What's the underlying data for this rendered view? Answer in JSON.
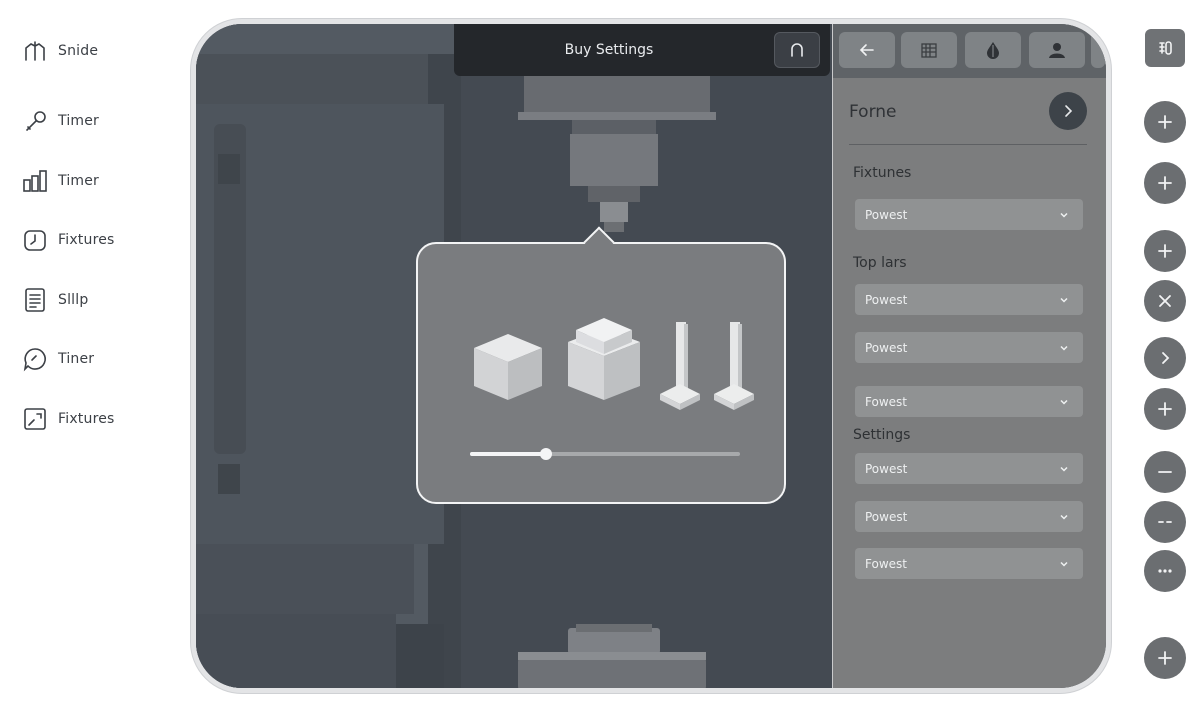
{
  "left_menu": [
    {
      "label": "Snide",
      "icon": "tuning-fork-icon"
    },
    {
      "label": "Timer",
      "icon": "wrench-icon"
    },
    {
      "label": "Timer",
      "icon": "bar-chart-icon"
    },
    {
      "label": "Fixtures",
      "icon": "clock-icon"
    },
    {
      "label": "Slllp",
      "icon": "document-icon"
    },
    {
      "label": "Tiner",
      "icon": "chat-bubble-icon"
    },
    {
      "label": "Fixtures",
      "icon": "image-frame-icon"
    }
  ],
  "topbar": {
    "title": "Buy Settings",
    "home_icon": "arch-icon"
  },
  "panel": {
    "tabs": [
      "back-arrow-icon",
      "calendar-icon",
      "drop-icon",
      "user-icon"
    ],
    "title": "Forne",
    "sections": [
      {
        "label": "Fixtunes",
        "dropdowns": [
          "Powest"
        ]
      },
      {
        "label": "Top lars",
        "dropdowns": [
          "Powest",
          "Powest",
          "Fowest"
        ]
      },
      {
        "label": "Settings",
        "dropdowns": [
          "Powest",
          "Powest",
          "Fowest"
        ]
      }
    ]
  },
  "popup": {
    "objects": [
      "cube-icon",
      "stacked-block-icon",
      "pin-icon",
      "pin-icon"
    ],
    "slider_value": 0.28
  },
  "rail": {
    "top_icon": "panel-toggle-icon",
    "buttons": [
      "plus",
      "plus",
      "plus",
      "close",
      "chevron-right",
      "plus",
      "minus",
      "dash",
      "more",
      "plus"
    ]
  },
  "colors": {
    "scene": "#444a52",
    "panel": "#7c7d7e",
    "rail_button": "#6b6e71",
    "topbar": "#24272b"
  }
}
